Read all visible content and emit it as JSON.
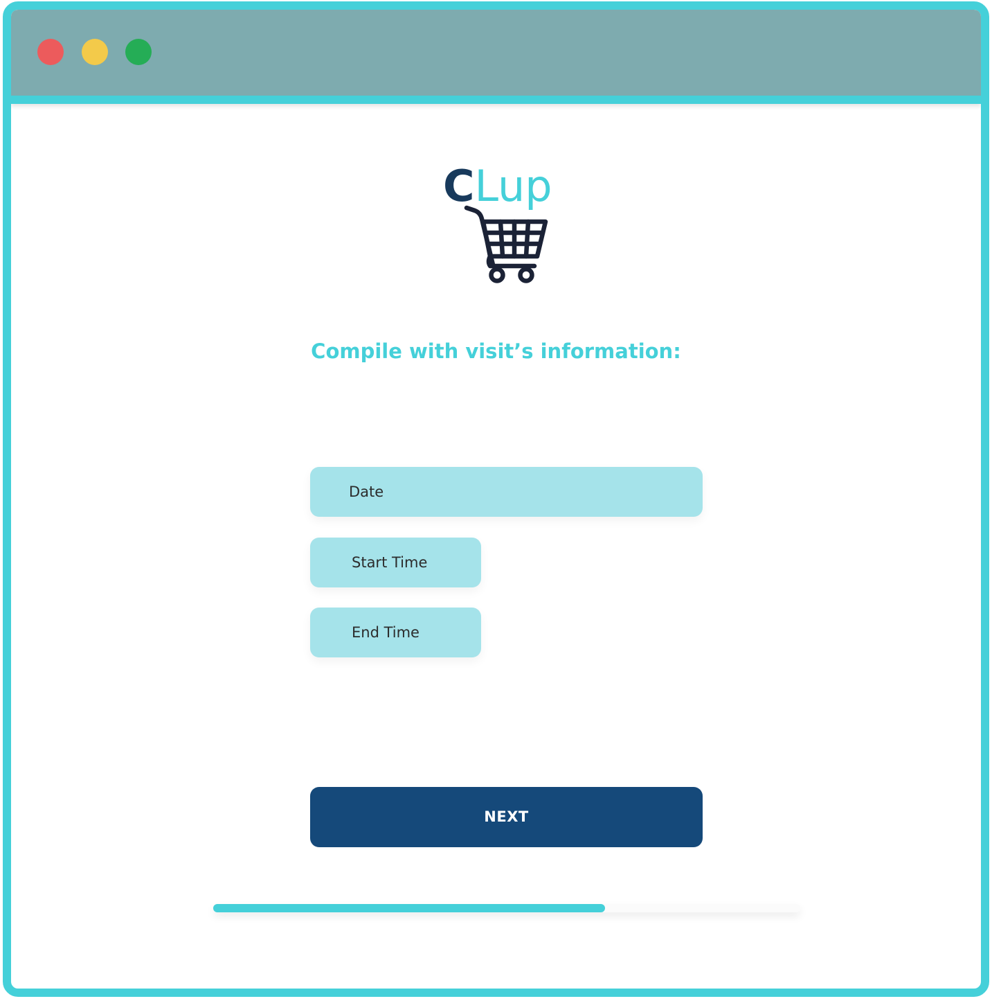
{
  "window": {
    "controls": [
      "close",
      "minimize",
      "maximize"
    ],
    "colors": {
      "frame": "#45d0d9",
      "titlebar": "#7eabaf",
      "close": "#ec5b5c",
      "minimize": "#f3ca4a",
      "maximize": "#25ad56"
    }
  },
  "logo": {
    "bold_letter": "C",
    "rest": "Lup",
    "icon": "shopping-cart-icon"
  },
  "heading": "Compile with visit’s information:",
  "form": {
    "date_placeholder": "Date",
    "start_time_placeholder": "Start Time",
    "end_time_placeholder": "End Time"
  },
  "next_label": "NEXT",
  "progress": {
    "fraction": 0.667
  },
  "colors": {
    "accent": "#45d0d9",
    "field": "#a5e3ea",
    "button": "#15497a",
    "brand_dark": "#183a5c"
  }
}
